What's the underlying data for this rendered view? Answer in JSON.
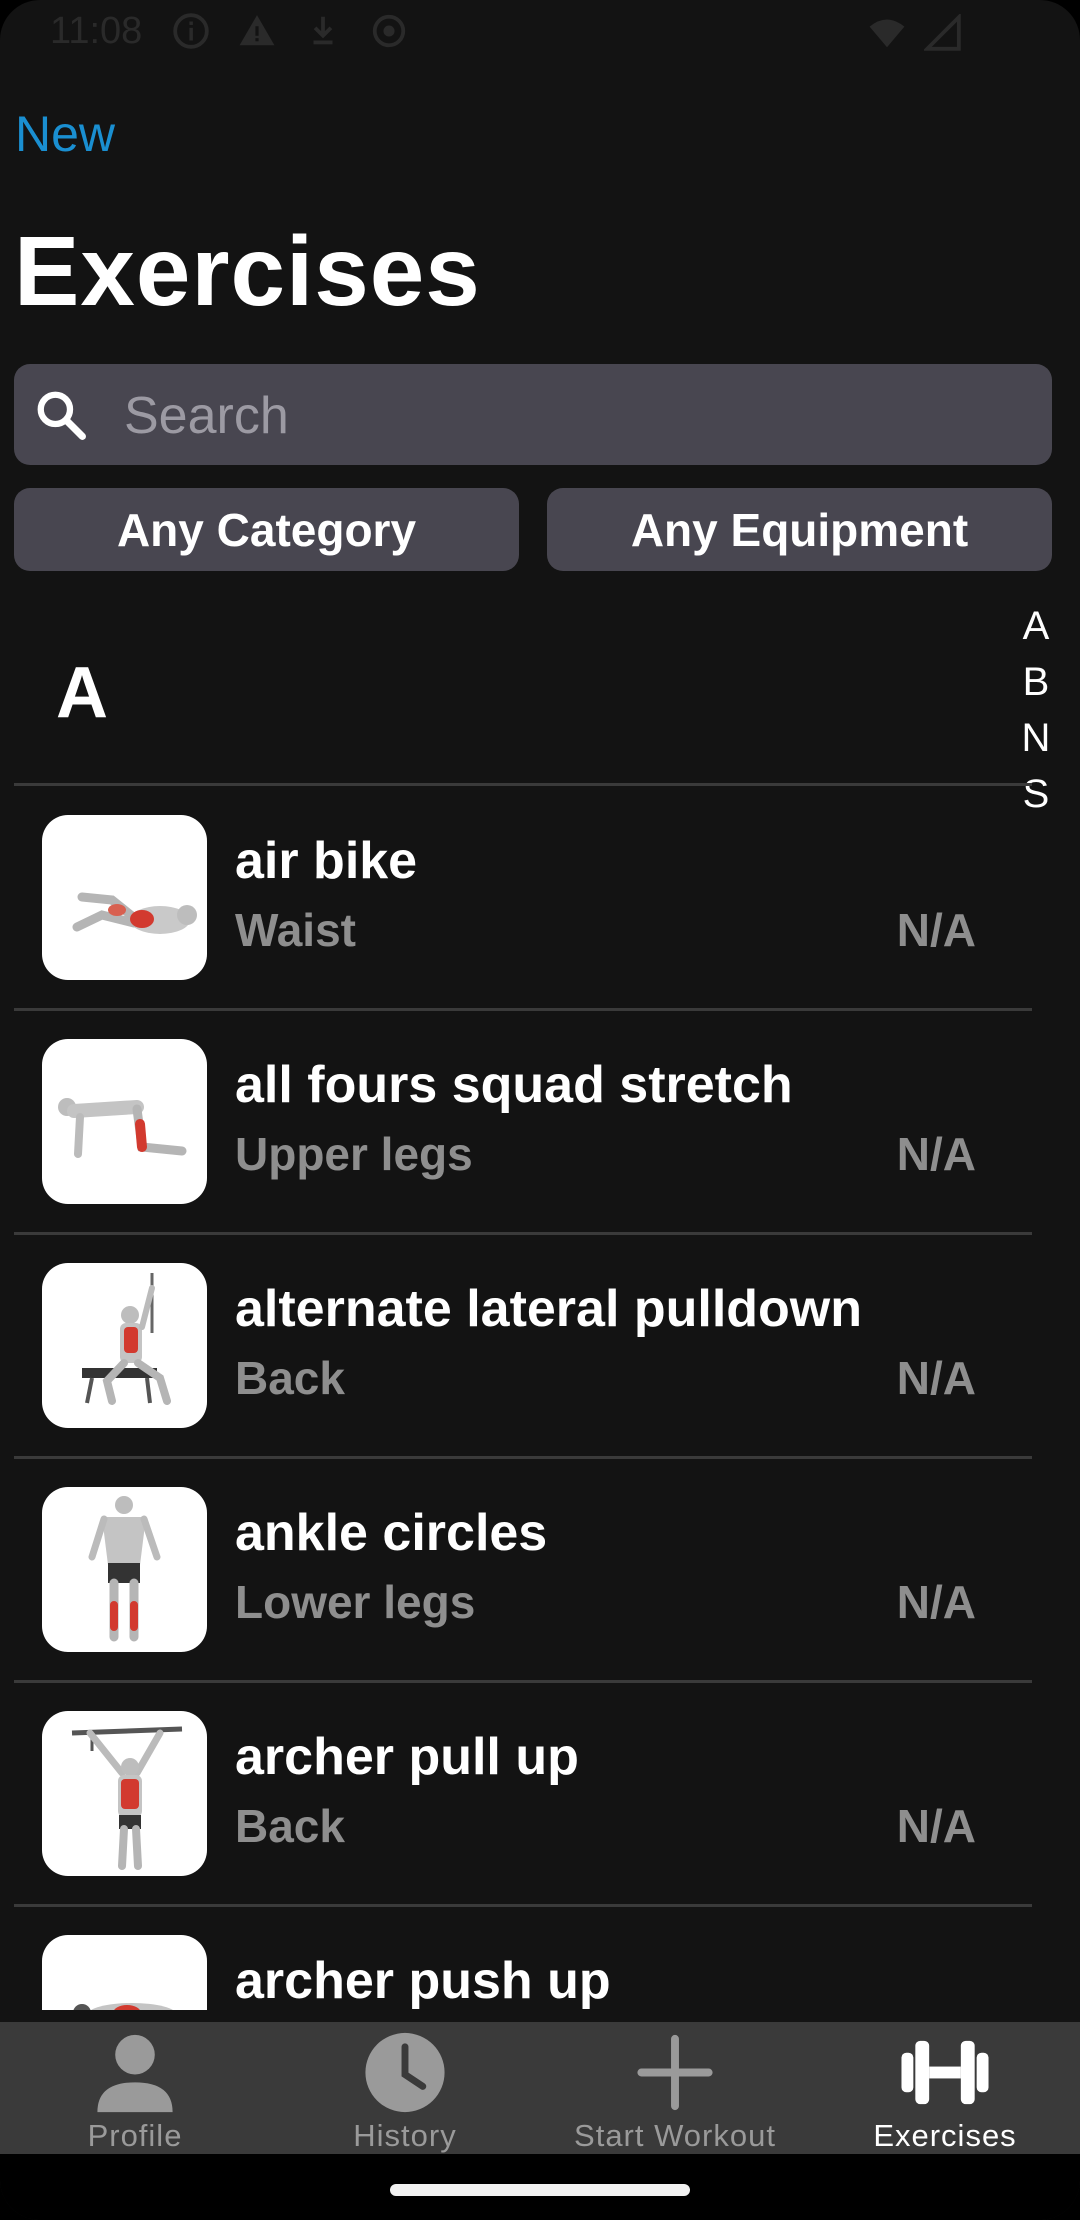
{
  "status_bar": {
    "time": "11:08"
  },
  "header": {
    "new_label": "New",
    "title": "Exercises"
  },
  "search": {
    "placeholder": "Search"
  },
  "filters": {
    "category_label": "Any Category",
    "equipment_label": "Any Equipment"
  },
  "index_letters": [
    "A",
    "B",
    "N",
    "S"
  ],
  "section": {
    "letter": "A"
  },
  "exercises": [
    {
      "name": "air bike",
      "category": "Waist",
      "equipment": "N/A"
    },
    {
      "name": "all fours squad stretch",
      "category": "Upper legs",
      "equipment": "N/A"
    },
    {
      "name": "alternate lateral pulldown",
      "category": "Back",
      "equipment": "N/A"
    },
    {
      "name": "ankle circles",
      "category": "Lower legs",
      "equipment": "N/A"
    },
    {
      "name": "archer pull up",
      "category": "Back",
      "equipment": "N/A"
    },
    {
      "name": "archer push up",
      "category": "",
      "equipment": ""
    }
  ],
  "tabs": [
    {
      "label": "Profile",
      "icon": "person-icon",
      "active": false
    },
    {
      "label": "History",
      "icon": "clock-icon",
      "active": false
    },
    {
      "label": "Start Workout",
      "icon": "plus-icon",
      "active": false
    },
    {
      "label": "Exercises",
      "icon": "dumbbell-icon",
      "active": true
    }
  ],
  "colors": {
    "accent": "#1a8fd1",
    "background": "#131313",
    "surface": "#484650",
    "muted_text": "#8e8e8e",
    "tab_bar": "#3a3a3a"
  }
}
